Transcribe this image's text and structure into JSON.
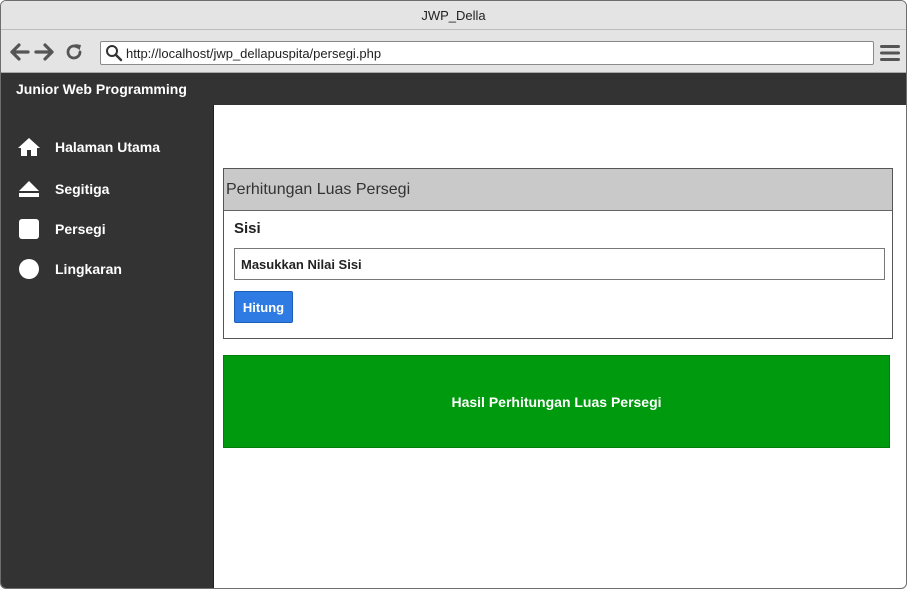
{
  "window": {
    "title": "JWP_Della"
  },
  "browser": {
    "url": "http://localhost/jwp_dellapuspita/persegi.php",
    "back_icon": "arrow-left-icon",
    "forward_icon": "arrow-right-icon",
    "reload_icon": "reload-icon",
    "menu_icon": "hamburger-menu-icon"
  },
  "header": {
    "title": "Junior Web Programming"
  },
  "sidebar": {
    "items": [
      {
        "label": "Halaman Utama",
        "icon": "home-icon"
      },
      {
        "label": "Segitiga",
        "icon": "eject-triangle-icon"
      },
      {
        "label": "Persegi",
        "icon": "square-icon"
      },
      {
        "label": "Lingkaran",
        "icon": "circle-icon"
      }
    ]
  },
  "form": {
    "title": "Perhitungan Luas Persegi",
    "field_label": "Sisi",
    "input_placeholder": "Masukkan Nilai Sisi",
    "input_value": "",
    "button_label": "Hitung"
  },
  "result": {
    "text": "Hasil Perhitungan Luas Persegi"
  },
  "colors": {
    "dark": "#333333",
    "accent_button": "#2e7be4",
    "result_green": "#009a0e",
    "panel_header": "#c9c9c9"
  }
}
